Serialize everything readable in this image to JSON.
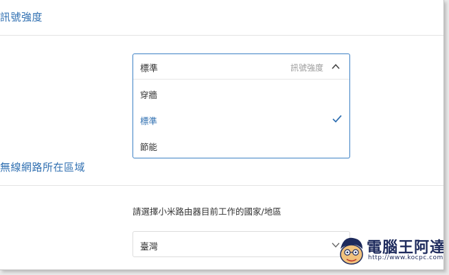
{
  "signal_section": {
    "title": "訊號強度",
    "select": {
      "value": "標準",
      "placeholder": "訊號強度",
      "options": [
        {
          "label": "穿牆",
          "selected": false
        },
        {
          "label": "標準",
          "selected": true
        },
        {
          "label": "節能",
          "selected": false
        }
      ]
    }
  },
  "region_section": {
    "title": "無線網路所在區域",
    "helper": "請選擇小米路由器目前工作的國家/地區",
    "select": {
      "value": "臺灣"
    }
  },
  "watermark": {
    "name": "電腦王阿達",
    "url": "http://www.kocpc.com.tw"
  },
  "colors": {
    "accent": "#2f6fb1",
    "focus_border": "#3a7fc4"
  }
}
